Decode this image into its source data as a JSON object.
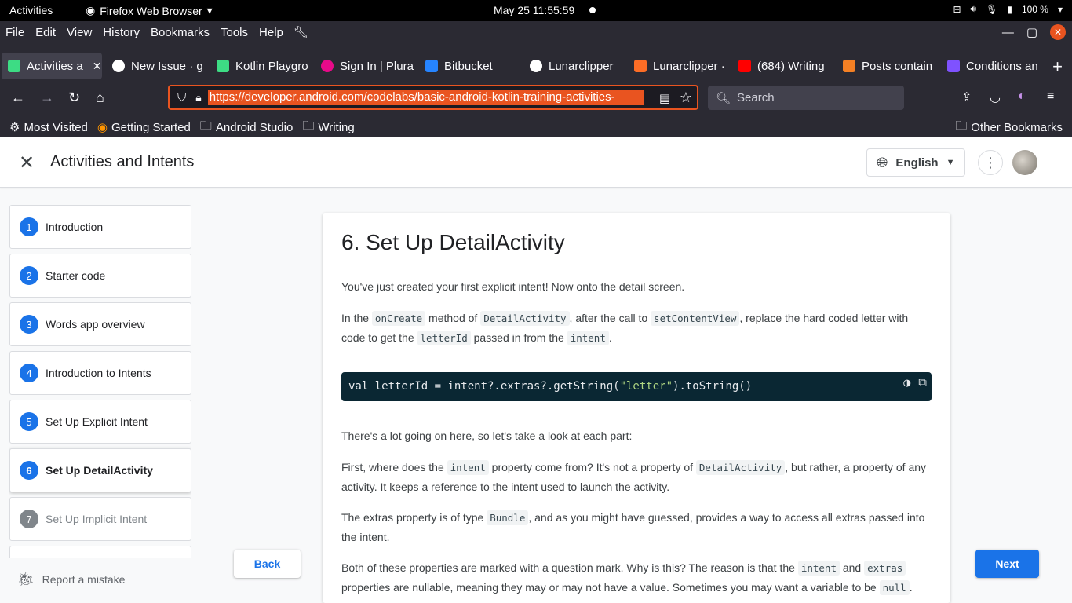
{
  "topbar": {
    "activities": "Activities",
    "app_name": "Firefox Web Browser",
    "clock": "May 25  11:55:59",
    "battery": "100 %"
  },
  "menubar": {
    "items": [
      "File",
      "Edit",
      "View",
      "History",
      "Bookmarks",
      "Tools",
      "Help"
    ]
  },
  "tabs": [
    {
      "label": "Activities a",
      "color": "#3ddc84",
      "icon": "android-icon"
    },
    {
      "label": "New Issue · g",
      "color": "#ffffff",
      "icon": "github-icon"
    },
    {
      "label": "Kotlin Playgro",
      "color": "#3ddc84",
      "icon": "android-icon"
    },
    {
      "label": "Sign In | Plura",
      "color": "#e80a89",
      "icon": "pluralsight-icon"
    },
    {
      "label": "Bitbucket",
      "color": "#2684ff",
      "icon": "bitbucket-icon"
    },
    {
      "label": "Lunarclipper",
      "color": "#ffffff",
      "icon": "github-icon"
    },
    {
      "label": "Lunarclipper ·",
      "color": "#fc6d26",
      "icon": "gitlab-icon"
    },
    {
      "label": "(684) Writing",
      "color": "#ff0000",
      "icon": "youtube-icon"
    },
    {
      "label": "Posts contain",
      "color": "#f48024",
      "icon": "stackoverflow-icon"
    },
    {
      "label": "Conditions an",
      "color": "#7f52ff",
      "icon": "kotlin-icon"
    }
  ],
  "navbar": {
    "url": "https://developer.android.com/codelabs/basic-android-kotlin-training-activities-",
    "search_placeholder": "Search"
  },
  "bookmarks": {
    "most_visited": "Most Visited",
    "getting_started": "Getting Started",
    "android_studio": "Android Studio",
    "writing": "Writing",
    "other": "Other Bookmarks"
  },
  "page": {
    "title": "Activities and Intents",
    "language": "English",
    "report": "Report a mistake",
    "back": "Back",
    "next": "Next"
  },
  "steps": [
    {
      "num": "1",
      "label": "Introduction"
    },
    {
      "num": "2",
      "label": "Starter code"
    },
    {
      "num": "3",
      "label": "Words app overview"
    },
    {
      "num": "4",
      "label": "Introduction to Intents"
    },
    {
      "num": "5",
      "label": "Set Up Explicit Intent"
    },
    {
      "num": "6",
      "label": "Set Up DetailActivity"
    },
    {
      "num": "7",
      "label": "Set Up Implicit Intent"
    }
  ],
  "article": {
    "heading": "6. Set Up DetailActivity",
    "p1": "You've just created your first explicit intent! Now onto the detail screen.",
    "p2": {
      "t1": "In the ",
      "c1": "onCreate",
      "t2": " method of ",
      "c2": "DetailActivity",
      "t3": ", after the call to ",
      "c3": "setContentView",
      "t4": ", replace the hard coded letter with code to get the ",
      "c4": "letterId",
      "t5": " passed in from the ",
      "c5": "intent",
      "t6": "."
    },
    "code": {
      "before": "val letterId = intent?.extras?.getString(",
      "string": "\"letter\"",
      "after": ").toString()"
    },
    "p3": "There's a lot going on here, so let's take a look at each part:",
    "p4": {
      "t1": "First, where does the ",
      "c1": "intent",
      "t2": " property come from? It's not a property of ",
      "c2": "DetailActivity",
      "t3": ", but rather, a property of any activity. It keeps a reference to the intent used to launch the activity."
    },
    "p5": {
      "t1": "The extras property is of type ",
      "c1": "Bundle",
      "t2": ", and as you might have guessed, provides a way to access all extras passed into the intent."
    },
    "p6": {
      "t1": "Both of these properties are marked with a question mark. Why is this? The reason is that the ",
      "c1": "intent",
      "t2": " and ",
      "c2": "extras",
      "t3": " properties are nullable, meaning they may or may not have a value. Sometimes you may want a variable to be ",
      "c3": "null",
      "t4": ". The"
    }
  }
}
